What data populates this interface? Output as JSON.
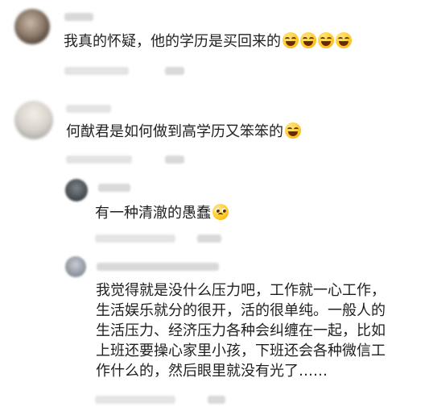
{
  "comments": [
    {
      "text": "我真的怀疑，他的学历是买回来的",
      "emojis": [
        "rofl-emoji",
        "rofl-emoji",
        "rofl-emoji",
        "rofl-emoji"
      ]
    },
    {
      "text": "何猷君是如何做到高学历又笨笨的",
      "emojis": [
        "rofl-emoji"
      ]
    }
  ],
  "replies": [
    {
      "text": "有一种清澈的愚蠢",
      "emojis": [
        "pleading-emoji"
      ]
    },
    {
      "lines": [
        "我觉得就是没什么压力吧，工作就一心工作，",
        "生活娱乐就分的很开，活的很单纯。一般人的",
        "生活压力、经济压力各种会纠缠在一起，比如",
        "上班还要操心家里小孩，下班还会各种微信工",
        "作什么的，然后眼里就没有光了……"
      ]
    }
  ]
}
